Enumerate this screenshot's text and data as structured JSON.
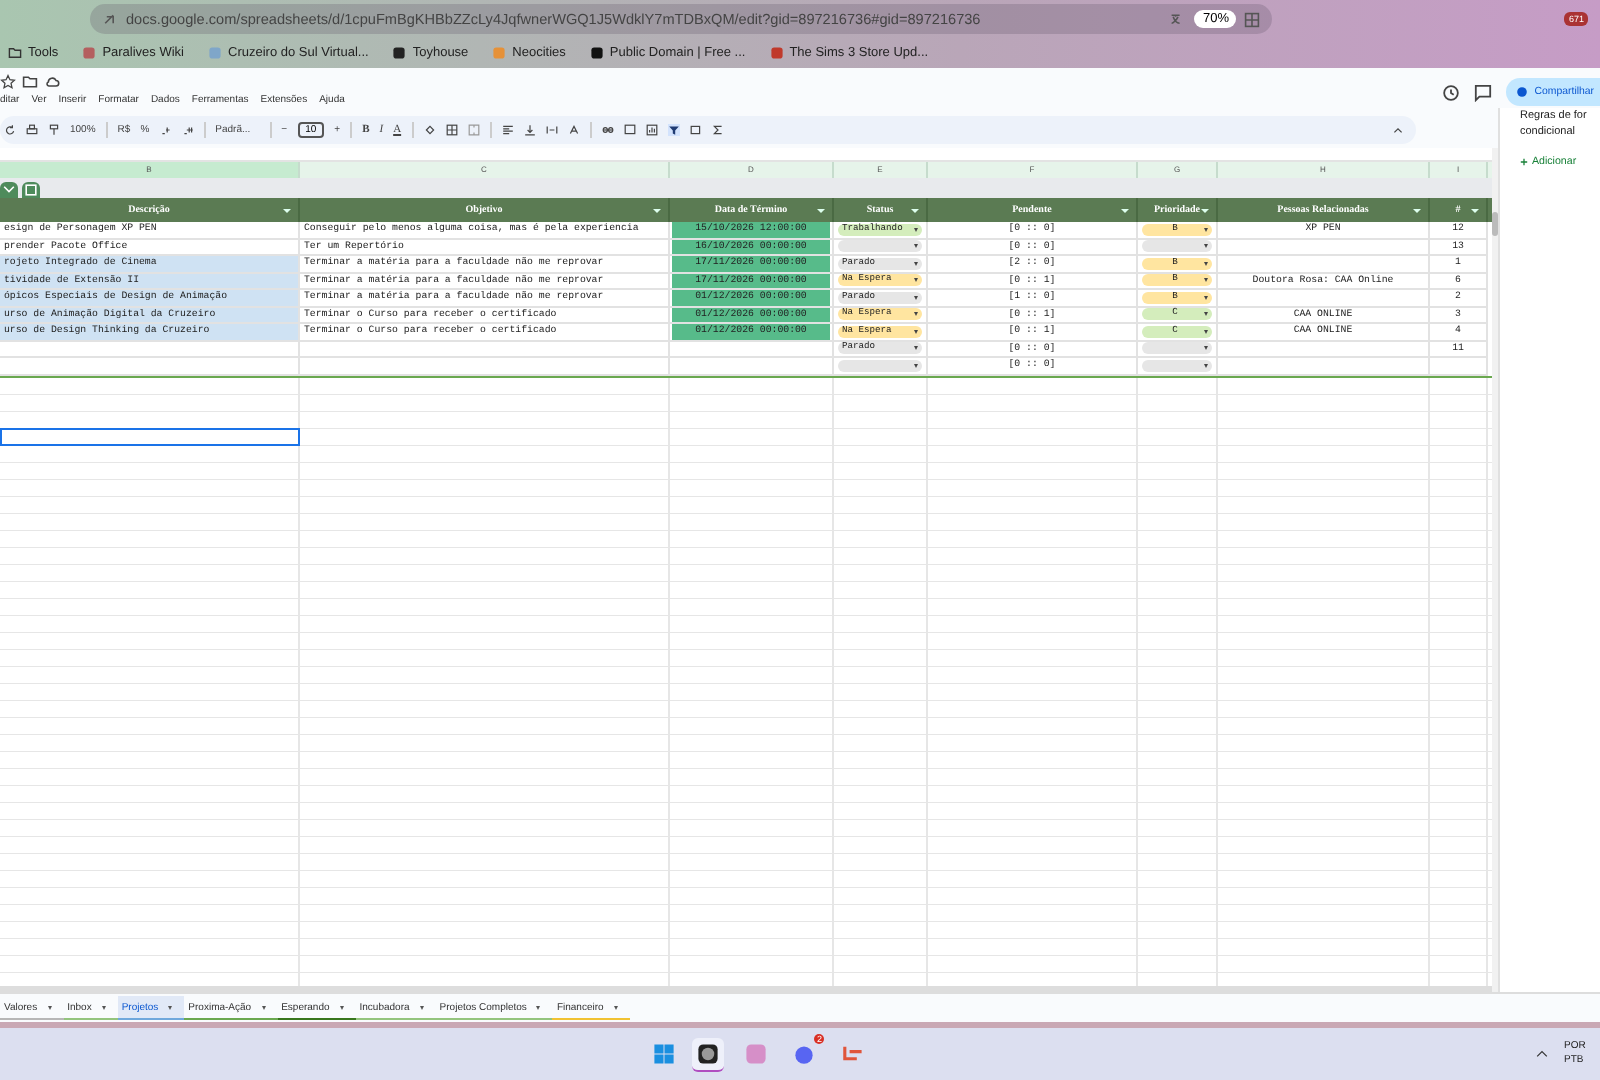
{
  "browser": {
    "url": "docs.google.com/spreadsheets/d/1cpuFmBgKHBbZZcLy4JqfwnerWGQ1J5WdklY7mTDBxQM/edit?gid=897216736#gid=897216736",
    "zoom": "70%",
    "extension_badge": "671",
    "bookmarks": [
      "Tools",
      "Paralives Wiki",
      "Cruzeiro do Sul Virtual...",
      "Toyhouse",
      "Neocities",
      "Public Domain | Free ...",
      "The Sims 3 Store Upd..."
    ]
  },
  "menu": [
    "ditar",
    "Ver",
    "Inserir",
    "Formatar",
    "Dados",
    "Ferramentas",
    "Extensões",
    "Ajuda"
  ],
  "toolbar": {
    "zoom": "100%",
    "currency": "R$",
    "percent": "%",
    "font": "Padrã...",
    "minus": "−",
    "font_size": "10",
    "plus": "+",
    "format_letters": [
      "B",
      "I",
      "A"
    ]
  },
  "share_button": "Compartilhar",
  "columns": [
    "B",
    "C",
    "D",
    "E",
    "F",
    "G",
    "H",
    "I"
  ],
  "table": {
    "headers": [
      "Descrição",
      "Objetivo",
      "Data de Término",
      "Status",
      "Pendente",
      "Prioridade",
      "Pessoas Relacionadas",
      "#"
    ],
    "rows": [
      {
        "description": "esign de Personagem XP PEN",
        "objective": "Conseguir pelo menos alguma coisa, mas é pela experiencia",
        "end_date": "15/10/2026 12:00:00",
        "status": {
          "label": "Trabalhando",
          "color": "#d4edbc"
        },
        "pending": "[0 :: 0]",
        "priority": {
          "label": "B",
          "color": "#ffe5a0"
        },
        "people": "XP PEN",
        "number": "12",
        "highlighted": false
      },
      {
        "description": "prender Pacote Office",
        "objective": "Ter um Repertório",
        "end_date": "16/10/2026 00:00:00",
        "status": {
          "color": "#e6e6e6"
        },
        "pending": "[0 :: 0]",
        "priority": {
          "color": "#e6e6e6"
        },
        "number": "13",
        "highlighted": false
      },
      {
        "description": "rojeto Integrado de Cinema",
        "objective": "Terminar a matéria para a faculdade não me reprovar",
        "end_date": "17/11/2026 00:00:00",
        "status": {
          "label": "Parado",
          "color": "#e6e6e6"
        },
        "pending": "[2 :: 0]",
        "priority": {
          "label": "B",
          "color": "#ffe5a0"
        },
        "number": "1",
        "highlighted": true
      },
      {
        "description": "tividade de Extensão II",
        "objective": "Terminar a matéria para a faculdade não me reprovar",
        "end_date": "17/11/2026 00:00:00",
        "status": {
          "label": "Na Espera",
          "color": "#ffe5a0"
        },
        "pending": "[0 :: 1]",
        "priority": {
          "label": "B",
          "color": "#ffe5a0"
        },
        "people": "Doutora Rosa: CAA Online",
        "number": "6",
        "highlighted": true
      },
      {
        "description": "ópicos Especiais de Design de Animação",
        "objective": "Terminar a matéria para a faculdade não me reprovar",
        "end_date": "01/12/2026 00:00:00",
        "status": {
          "label": "Parado",
          "color": "#e6e6e6"
        },
        "pending": "[1 :: 0]",
        "priority": {
          "label": "B",
          "color": "#ffe5a0"
        },
        "number": "2",
        "highlighted": true
      },
      {
        "description": "urso de Animação Digital da Cruzeiro",
        "objective": "Terminar o Curso para receber o certificado",
        "end_date": "01/12/2026 00:00:00",
        "status": {
          "label": "Na Espera",
          "color": "#ffe5a0"
        },
        "pending": "[0 :: 1]",
        "priority": {
          "label": "C",
          "color": "#d4edbc"
        },
        "people": "CAA ONLINE",
        "number": "3",
        "highlighted": true
      },
      {
        "description": "urso de Design Thinking da Cruzeiro",
        "objective": "Terminar o Curso para receber o certificado",
        "end_date": "01/12/2026 00:00:00",
        "status": {
          "label": "Na Espera",
          "color": "#ffe5a0"
        },
        "pending": "[0 :: 1]",
        "priority": {
          "label": "C",
          "color": "#d4edbc"
        },
        "people": "CAA ONLINE",
        "number": "4",
        "highlighted": true
      },
      {
        "status": {
          "label": "Parado",
          "color": "#e6e6e6"
        },
        "pending": "[0 :: 0]",
        "priority": {
          "color": "#e6e6e6"
        },
        "number": "11",
        "highlighted": false
      },
      {
        "status": {
          "color": "#e6e6e6"
        },
        "pending": "[0 :: 0]",
        "priority": {
          "color": "#e6e6e6"
        },
        "highlighted": false
      }
    ]
  },
  "side_panel": {
    "title": "Regras de for condicional",
    "add_link": "Adicionar"
  },
  "sheet_tabs": [
    {
      "label": "Valores",
      "selected": false,
      "color": "#b7b7b7"
    },
    {
      "label": "Inbox",
      "selected": false,
      "color": "#93c47d"
    },
    {
      "label": "Projetos",
      "selected": true,
      "color": "#6fa8dc"
    },
    {
      "label": "Proxima-Ação",
      "selected": false,
      "color": "#6aa84f"
    },
    {
      "label": "Esperando",
      "selected": false,
      "color": "#38761d"
    },
    {
      "label": "Incubadora",
      "selected": false,
      "color": "#93c47d"
    },
    {
      "label": "Projetos Completos",
      "selected": false,
      "color": "#93c47d"
    },
    {
      "label": "Financeiro",
      "selected": false,
      "color": "#f1c232"
    }
  ],
  "taskbar": {
    "chat_badge": "2",
    "language": "POR",
    "layout": "PTB"
  }
}
